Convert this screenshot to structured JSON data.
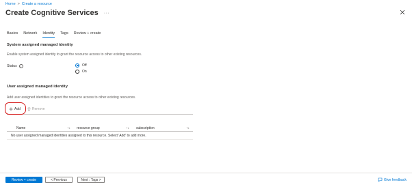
{
  "breadcrumb": {
    "home": "Home",
    "separator": ">",
    "create": "Create a resource"
  },
  "header": {
    "title": "Create Cognitive Services",
    "more": "···"
  },
  "tabs": [
    {
      "label": "Basics",
      "active": false
    },
    {
      "label": "Network",
      "active": false
    },
    {
      "label": "Identity",
      "active": true
    },
    {
      "label": "Tags",
      "active": false
    },
    {
      "label": "Review + create",
      "active": false
    }
  ],
  "system_identity": {
    "title": "System assigned managed identity",
    "description": "Enable system assigned identity to grant the resource access to other existing resources.",
    "status_label": "Status",
    "info_icon": "i",
    "options": [
      {
        "label": "Off",
        "checked": true
      },
      {
        "label": "On",
        "checked": false
      }
    ]
  },
  "user_identity": {
    "title": "User assigned managed identity",
    "description": "Add user assigned identities to grant the resource access to other existing resources.",
    "add_label": "Add",
    "remove_label": "Remove",
    "columns": [
      "Name",
      "resource group",
      "subscription"
    ],
    "sort_glyph": "↑↓",
    "empty_message": "No user assigned managed identities assigned to this resource. Select 'Add' to add more."
  },
  "footer": {
    "review_label": "Review + create",
    "prev_label": "< Previous",
    "next_label": "Next : Tags >",
    "feedback_label": "Give feedback"
  },
  "colors": {
    "accent": "#0078d4",
    "annotation": "#d41717"
  }
}
